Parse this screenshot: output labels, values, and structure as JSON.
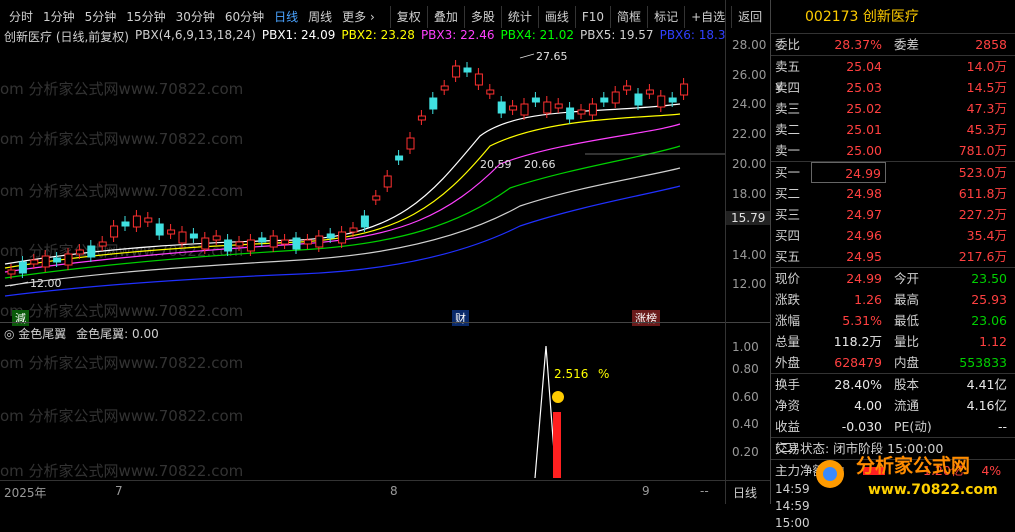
{
  "toolbar": {
    "periods": [
      "分时",
      "1分钟",
      "5分钟",
      "15分钟",
      "30分钟",
      "60分钟",
      "日线",
      "周线",
      "更多 ›"
    ],
    "active_period": "日线",
    "buttons": [
      "复权",
      "叠加",
      "多股",
      "统计",
      "画线",
      "F10",
      "简框",
      "标记",
      "+自选",
      "返回"
    ]
  },
  "chart_info": {
    "title": "创新医疗 (日线,前复权)",
    "indicator": "PBX(4,6,9,13,18,24)",
    "pbx1": "PBX1: 24.09",
    "pbx2": "PBX2: 23.28",
    "pbx3": "PBX3: 22.46",
    "pbx4": "PBX4: 21.02",
    "pbx5": "PBX5: 19.57",
    "pbx6": "PBX6: 18.3"
  },
  "main_y_labels": [
    "28.00",
    "26.00",
    "24.00",
    "22.00",
    "20.00",
    "18.00",
    "15.79",
    "14.00",
    "12.00"
  ],
  "annotations": {
    "high": "27.65",
    "low": "12.00",
    "mid1": "20.59",
    "mid2": "20.66"
  },
  "tags": {
    "t1": "減",
    "t2": "财",
    "t3": "涨榜"
  },
  "indicator_panel": {
    "name": "金色尾翼",
    "value_label": "金色尾翼: 0.00",
    "pct": "2.516",
    "pct_unit": "%"
  },
  "ind_y_labels": [
    "1.00",
    "0.80",
    "0.60",
    "0.40",
    "0.20"
  ],
  "x_axis": {
    "labels": [
      "2025年",
      "7",
      "8",
      "9",
      "--"
    ],
    "period": "日线"
  },
  "watermark": "om 分析家公式网www.70822.com",
  "quote": {
    "code_name": "002173 创新医疗",
    "weibi_label": "委比",
    "weibi": "28.37%",
    "weicha_label": "委差",
    "weicha": "2858",
    "asks": [
      {
        "label": "卖五 ¥",
        "price": "25.04",
        "vol": "14.0万"
      },
      {
        "label": "卖四",
        "price": "25.03",
        "vol": "14.5万"
      },
      {
        "label": "卖三",
        "price": "25.02",
        "vol": "47.3万"
      },
      {
        "label": "卖二",
        "price": "25.01",
        "vol": "45.3万"
      },
      {
        "label": "卖一",
        "price": "25.00",
        "vol": "781.0万"
      }
    ],
    "bids": [
      {
        "label": "买一",
        "price": "24.99",
        "vol": "523.0万"
      },
      {
        "label": "买二",
        "price": "24.98",
        "vol": "611.8万"
      },
      {
        "label": "买三",
        "price": "24.97",
        "vol": "227.2万"
      },
      {
        "label": "买四",
        "price": "24.96",
        "vol": "35.4万"
      },
      {
        "label": "买五",
        "price": "24.95",
        "vol": "217.6万"
      }
    ],
    "stats": [
      {
        "l1": "现价",
        "v1": "24.99",
        "c1": "red",
        "l2": "今开",
        "v2": "23.50",
        "c2": "green"
      },
      {
        "l1": "涨跌",
        "v1": "1.26",
        "c1": "red",
        "l2": "最高",
        "v2": "25.93",
        "c2": "red"
      },
      {
        "l1": "涨幅",
        "v1": "5.31%",
        "c1": "red",
        "l2": "最低",
        "v2": "23.06",
        "c2": "green"
      },
      {
        "l1": "总量",
        "v1": "118.2万",
        "c1": "white",
        "l2": "量比",
        "v2": "1.12",
        "c2": "red"
      },
      {
        "l1": "外盘",
        "v1": "628479",
        "c1": "red",
        "l2": "内盘",
        "v2": "553833",
        "c2": "green"
      }
    ],
    "stats2": [
      {
        "l1": "换手",
        "v1": "28.40%",
        "c1": "white",
        "l2": "股本",
        "v2": "4.41亿",
        "c2": "white"
      },
      {
        "l1": "净资",
        "v1": "4.00",
        "c1": "white",
        "l2": "流通",
        "v2": "4.16亿",
        "c2": "white"
      },
      {
        "l1": "收益(二)",
        "v1": "-0.030",
        "c1": "white",
        "l2": "PE(动)",
        "v2": "--",
        "c2": "white"
      }
    ],
    "trade_status": "交易状态: 闭市阶段 15:00:00",
    "main_flow_label": "主力净额",
    "main_flow_value": "1.20亿",
    "main_flow_pct": "4%",
    "ticks": [
      "14:59",
      "14:59",
      "15:00"
    ]
  },
  "logo": {
    "text": "分析家公式网",
    "url_text": "www.70822.com"
  }
}
